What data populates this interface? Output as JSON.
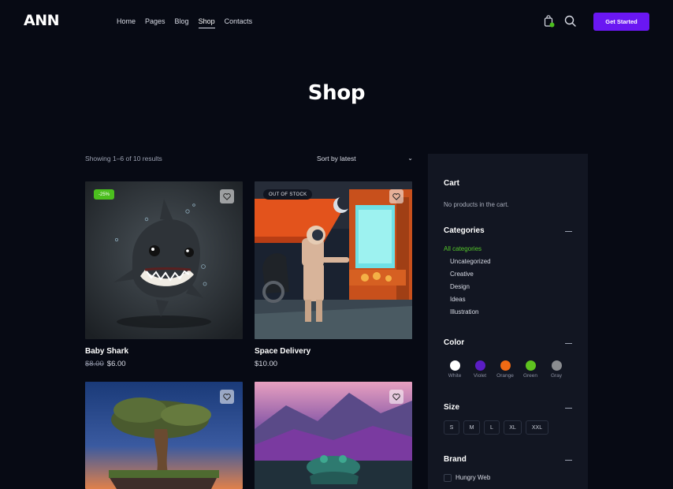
{
  "header": {
    "logo": "ANN",
    "nav": [
      "Home",
      "Pages",
      "Blog",
      "Shop",
      "Contacts"
    ],
    "active_nav": "Shop",
    "cta_label": "Get Started",
    "accent_color": "#6a17f2"
  },
  "page_title": "Shop",
  "toolbar": {
    "results_text": "Showing 1–6 of 10 results",
    "sort_label": "Sort by latest"
  },
  "products": [
    {
      "name": "Baby Shark",
      "old_price": "$8.00",
      "price": "$6.00",
      "badge": "-25%"
    },
    {
      "name": "Space Delivery",
      "old_price": "",
      "price": "$10.00",
      "badge": "OUT OF STOCK"
    },
    {
      "name": "",
      "old_price": "",
      "price": "",
      "badge": ""
    },
    {
      "name": "",
      "old_price": "",
      "price": "",
      "badge": ""
    }
  ],
  "sidebar": {
    "cart_title": "Cart",
    "cart_empty": "No products in the cart.",
    "categories_title": "Categories",
    "categories": [
      "All categories",
      "Uncategorized",
      "Creative",
      "Design",
      "Ideas",
      "Illustration"
    ],
    "color_title": "Color",
    "colors": [
      {
        "name": "White",
        "hex": "#ffffff"
      },
      {
        "name": "Violet",
        "hex": "#5b1dc4"
      },
      {
        "name": "Orange",
        "hex": "#f06a14"
      },
      {
        "name": "Green",
        "hex": "#5ec21f"
      },
      {
        "name": "Gray",
        "hex": "#8a8c90"
      }
    ],
    "size_title": "Size",
    "sizes": [
      "S",
      "M",
      "L",
      "XL",
      "XXL"
    ],
    "brand_title": "Brand",
    "brands": [
      "Hungry Web"
    ]
  }
}
